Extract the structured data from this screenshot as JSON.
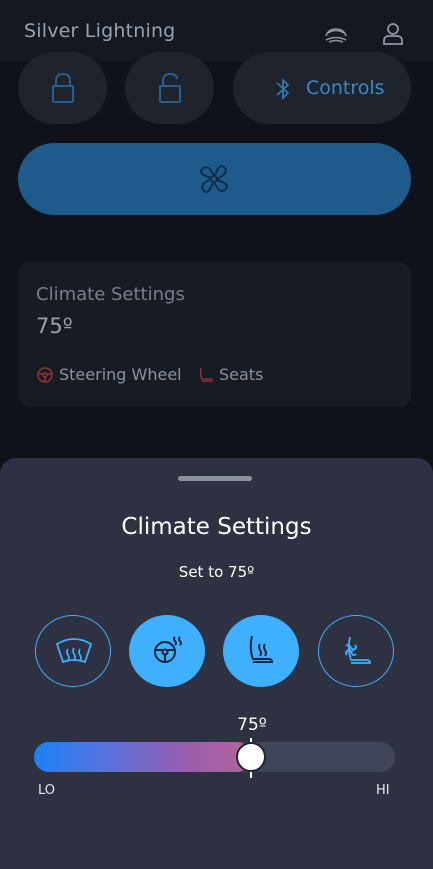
{
  "header": {
    "title": "Silver Lightning",
    "vehicle_icon": "car-icon",
    "profile_icon": "user-icon"
  },
  "quick_actions": {
    "lock_icon": "lock-icon",
    "unlock_icon": "unlock-icon",
    "controls_label": "Controls",
    "controls_icon": "bluetooth-icon",
    "fan_icon": "fan-icon"
  },
  "climate_card": {
    "title": "Climate Settings",
    "temperature": "75º",
    "tags": [
      {
        "label": "Steering Wheel",
        "icon": "steering-wheel-icon"
      },
      {
        "label": "Seats",
        "icon": "seat-icon"
      }
    ]
  },
  "sheet": {
    "title": "Climate Settings",
    "subtitle": "Set to 75º",
    "modes": [
      {
        "icon": "defrost-icon",
        "active": false
      },
      {
        "icon": "heated-steering-wheel-icon",
        "active": true
      },
      {
        "icon": "heated-seat-icon",
        "active": true
      },
      {
        "icon": "ventilated-seat-icon",
        "active": false
      }
    ],
    "slider": {
      "value_label": "75º",
      "level_fraction": 0.6,
      "lo_label": "LO",
      "hi_label": "HI"
    }
  },
  "colors": {
    "accent": "#3fb0ff",
    "sheet_bg": "#2d3141",
    "app_bg": "#0f1218"
  }
}
